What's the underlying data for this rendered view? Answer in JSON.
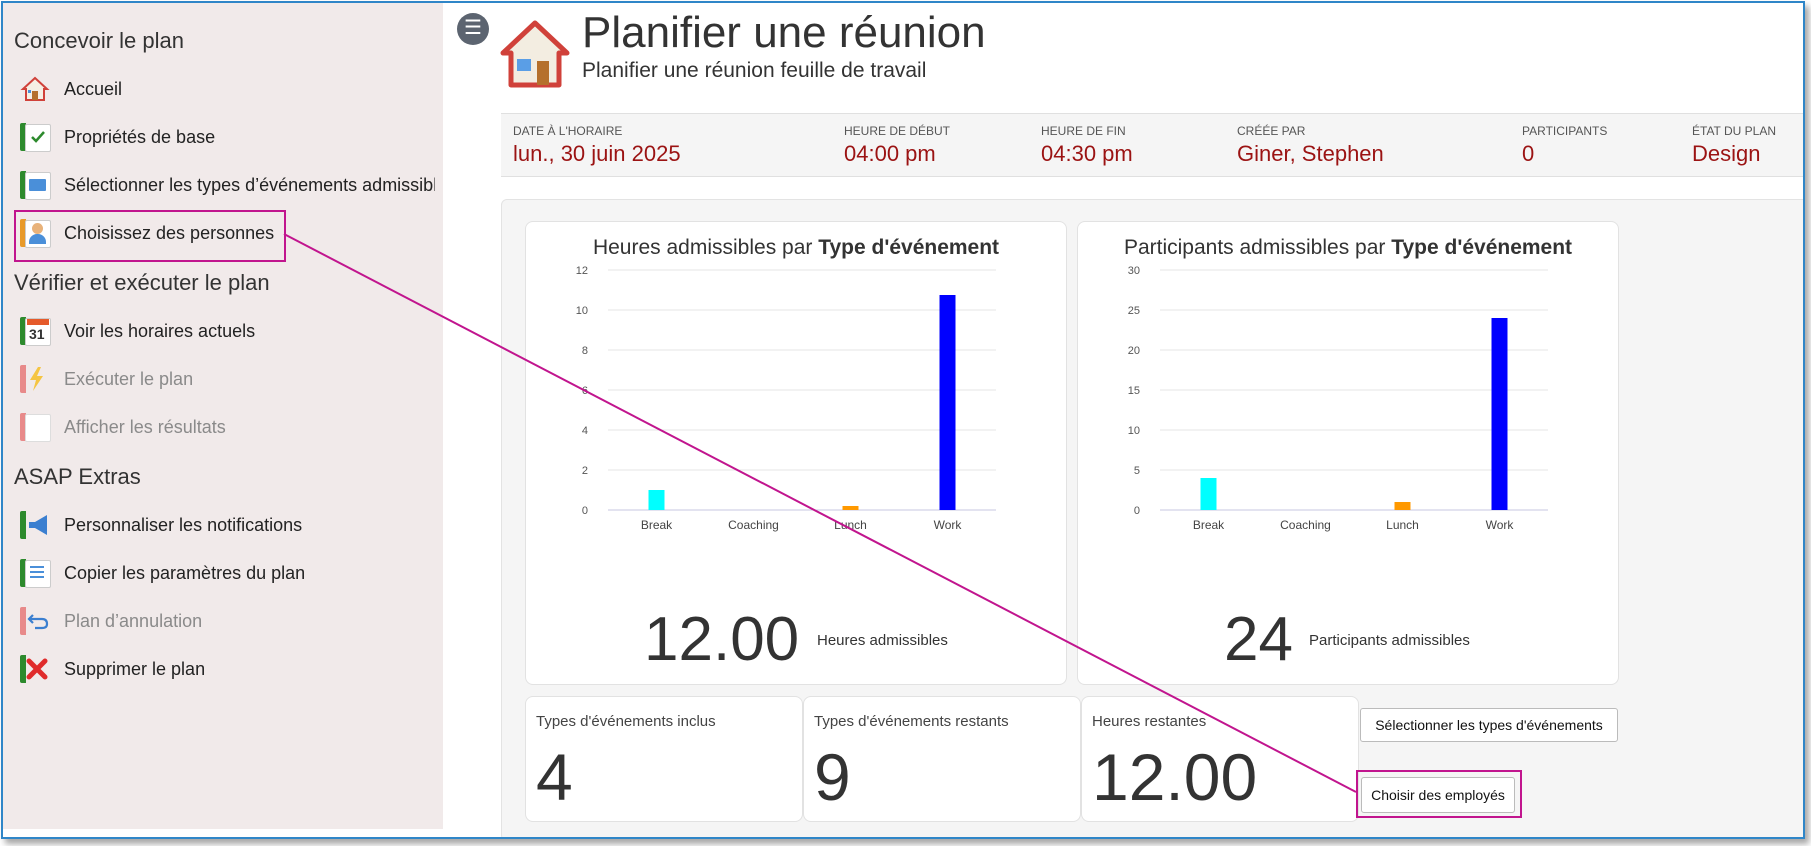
{
  "sidebar": {
    "sections": [
      {
        "title": "Concevoir le plan",
        "items": [
          {
            "label": "Accueil",
            "icon": "house-icon",
            "disabled": false
          },
          {
            "label": "Propriétés de base",
            "icon": "checklist-icon",
            "disabled": false
          },
          {
            "label": "Sélectionner les types d’événements admissibles",
            "icon": "monitor-icon",
            "disabled": false
          },
          {
            "label": "Choisissez des personnes",
            "icon": "person-icon",
            "disabled": false
          }
        ]
      },
      {
        "title": "Vérifier et exécuter le plan",
        "items": [
          {
            "label": "Voir les horaires actuels",
            "icon": "calendar-icon",
            "disabled": false
          },
          {
            "label": "Exécuter le plan",
            "icon": "lightning-icon",
            "disabled": true
          },
          {
            "label": "Afficher les résultats",
            "icon": "document-icon",
            "disabled": true
          }
        ]
      },
      {
        "title": "ASAP Extras",
        "items": [
          {
            "label": "Personnaliser les notifications",
            "icon": "megaphone-icon",
            "disabled": false
          },
          {
            "label": "Copier les paramètres du plan",
            "icon": "copy-icon",
            "disabled": false
          },
          {
            "label": "Plan d’annulation",
            "icon": "undo-icon",
            "disabled": true
          },
          {
            "label": "Supprimer le plan",
            "icon": "delete-icon",
            "disabled": false
          }
        ]
      }
    ]
  },
  "header": {
    "title": "Planifier une réunion",
    "subtitle": "Planifier une réunion feuille de travail"
  },
  "info": [
    {
      "label": "DATE À L'HORAIRE",
      "value": "lun., 30 juin 2025"
    },
    {
      "label": "HEURE DE DÉBUT",
      "value": "04:00 pm"
    },
    {
      "label": "HEURE DE FIN",
      "value": "04:30 pm"
    },
    {
      "label": "CRÉÉE PAR",
      "value": "Giner, Stephen"
    },
    {
      "label": "PARTICIPANTS",
      "value": "0"
    },
    {
      "label": "ÉTAT DU PLAN",
      "value": "Design"
    }
  ],
  "chart_data": [
    {
      "type": "bar",
      "title_prefix": "Heures admissibles par ",
      "title_bold": "Type d'événement",
      "categories": [
        "Break",
        "Coaching",
        "Lunch",
        "Work"
      ],
      "values": [
        1.0,
        0,
        0.2,
        10.75
      ],
      "colors": [
        "#00ffff",
        "#999999",
        "#ff9900",
        "#0000ff"
      ],
      "ylim": [
        0,
        12
      ],
      "yticks": [
        0,
        2,
        4,
        6,
        8,
        10,
        12
      ],
      "grid": true,
      "total": "12.00",
      "total_label": "Heures admissibles"
    },
    {
      "type": "bar",
      "title_prefix": "Participants admissibles par ",
      "title_bold": "Type d'événement",
      "categories": [
        "Break",
        "Coaching",
        "Lunch",
        "Work"
      ],
      "values": [
        4,
        0,
        1,
        24
      ],
      "colors": [
        "#00ffff",
        "#999999",
        "#ff9900",
        "#0000ff"
      ],
      "ylim": [
        0,
        30
      ],
      "yticks": [
        0,
        5,
        10,
        15,
        20,
        25,
        30
      ],
      "grid": true,
      "total": "24",
      "total_label": "Participants admissibles"
    }
  ],
  "stats": [
    {
      "label": "Types d'événements inclus",
      "value": "4"
    },
    {
      "label": "Types d'événements restants",
      "value": "9"
    },
    {
      "label": "Heures restantes",
      "value": "12.00"
    }
  ],
  "buttons": {
    "select_types": "Sélectionner les types d'événements",
    "choose_employees": "Choisir des employés"
  },
  "colors": {
    "sidebar_bg": "#f1eaea",
    "value_red": "#9b1313",
    "highlight": "#c1158e",
    "frame": "#2f86c8"
  }
}
